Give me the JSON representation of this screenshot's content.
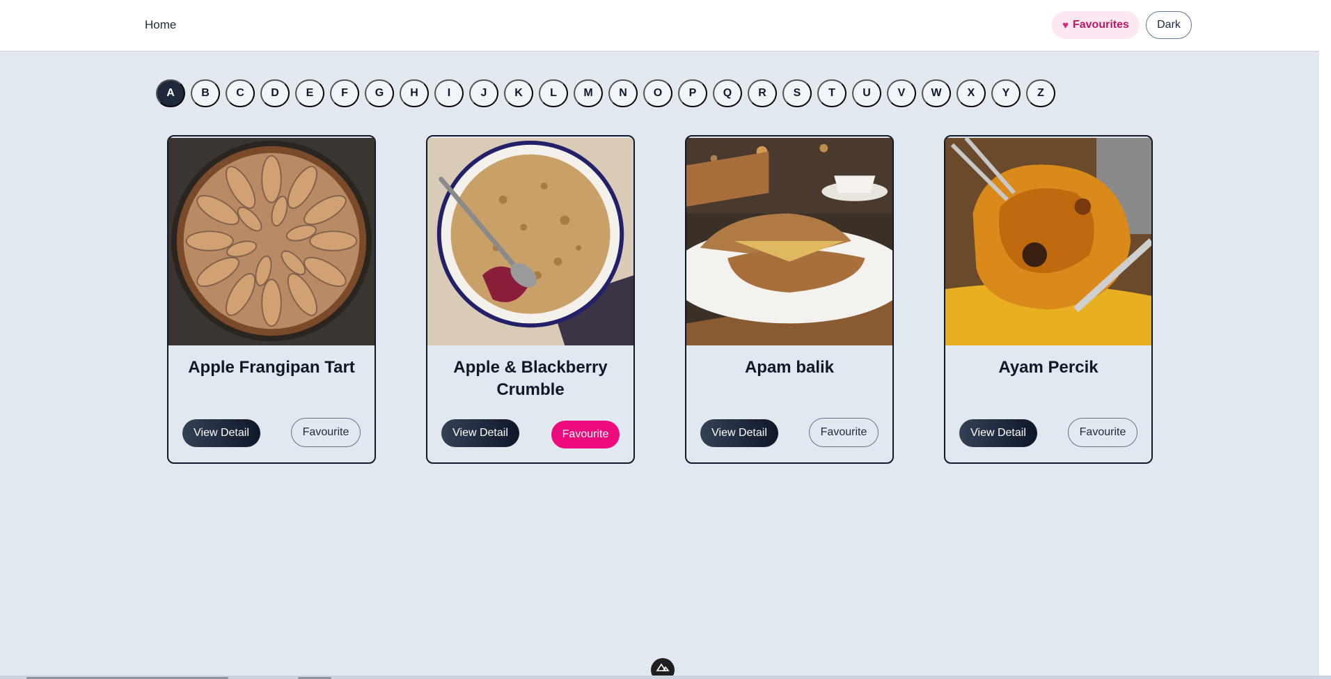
{
  "nav": {
    "home": "Home",
    "favourites": "Favourites",
    "dark": "Dark"
  },
  "letters": [
    "A",
    "B",
    "C",
    "D",
    "E",
    "F",
    "G",
    "H",
    "I",
    "J",
    "K",
    "L",
    "M",
    "N",
    "O",
    "P",
    "Q",
    "R",
    "S",
    "T",
    "U",
    "V",
    "W",
    "X",
    "Y",
    "Z"
  ],
  "active_letter": "A",
  "cards": [
    {
      "title": "Apple Frangipan Tart",
      "view": "View Detail",
      "favourite": "Favourite",
      "is_favourite": false
    },
    {
      "title": "Apple & Blackberry Crumble",
      "view": "View Detail",
      "favourite": "Favourite",
      "is_favourite": true
    },
    {
      "title": "Apam balik",
      "view": "View Detail",
      "favourite": "Favourite",
      "is_favourite": false
    },
    {
      "title": "Ayam Percik",
      "view": "View Detail",
      "favourite": "Favourite",
      "is_favourite": false
    }
  ],
  "colors": {
    "background": "#e2e8f0",
    "accent_pink": "#ec0a7c",
    "dark_navy": "#1e293b"
  },
  "icons": {
    "favourites_nav": "heart-icon",
    "devtools_badge": "nuxt-logo-icon"
  }
}
